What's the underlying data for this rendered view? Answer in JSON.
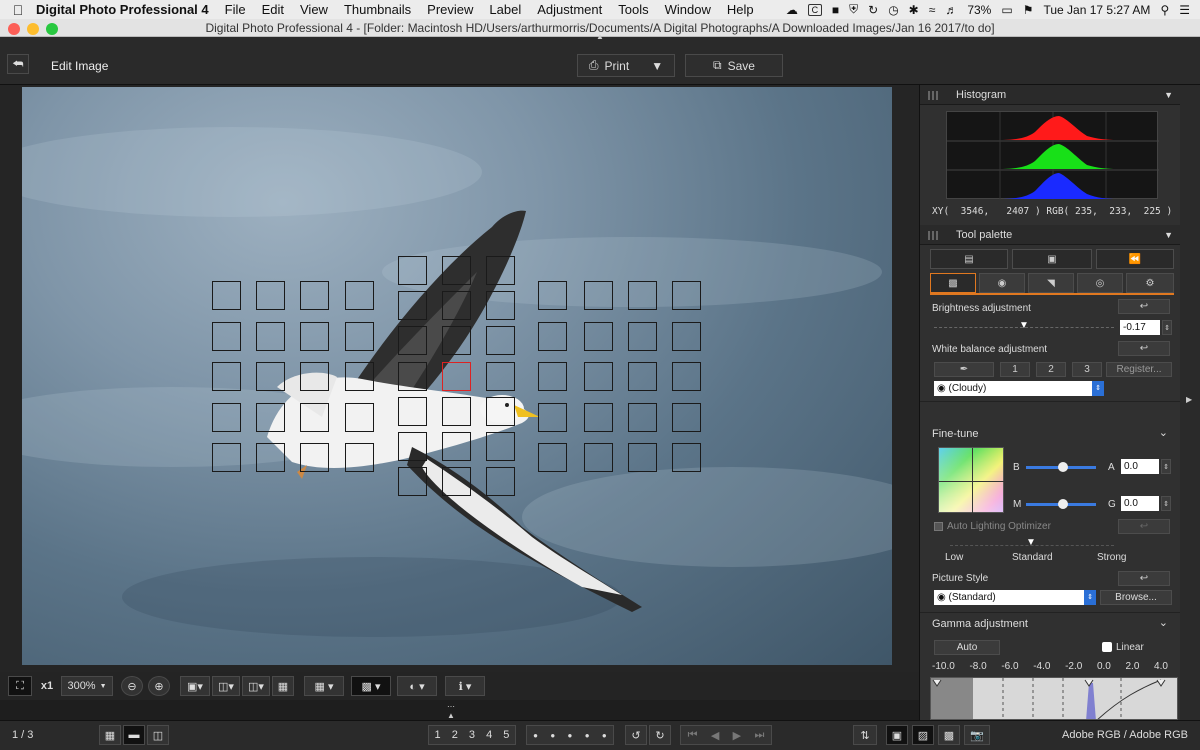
{
  "menubar": {
    "app_name": "Digital Photo Professional 4",
    "items": [
      "File",
      "Edit",
      "View",
      "Thumbnails",
      "Preview",
      "Label",
      "Adjustment",
      "Tools",
      "Window",
      "Help"
    ],
    "battery": "73%",
    "clock": "Tue Jan 17  5:27 AM"
  },
  "window": {
    "title": "Digital Photo Professional 4 - [Folder: Macintosh HD/Users/arthurmorris/Documents/A Digital Photographs/A Downloaded Images/Jan 16 2017/to do]"
  },
  "toolbar": {
    "mode_label": "Edit Image",
    "print_label": "Print",
    "save_label": "Save"
  },
  "histogram": {
    "title": "Histogram",
    "readout": "XY(  3546,   2407 ) RGB( 235,  233,  225 )"
  },
  "tool_palette": {
    "title": "Tool palette",
    "brightness_label": "Brightness adjustment",
    "brightness_value": "-0.17",
    "brightness_level": 0.5,
    "wb_label": "White balance adjustment",
    "wb_buttons": [
      "1",
      "2",
      "3"
    ],
    "register_label": "Register...",
    "wb_preset": "(Cloudy)"
  },
  "fine_tune": {
    "title": "Fine-tune",
    "b_label": "B",
    "a_label": "A",
    "a_value": "0.0",
    "m_label": "M",
    "g_label": "G",
    "g_value": "0.0",
    "alo_label": "Auto Lighting Optimizer",
    "alo_levels": [
      "Low",
      "Standard",
      "Strong"
    ],
    "picture_style_label": "Picture Style",
    "picture_style_value": "(Standard)",
    "browse_label": "Browse..."
  },
  "gamma": {
    "title": "Gamma adjustment",
    "auto_label": "Auto",
    "linear_label": "Linear",
    "scale": [
      "-10.0",
      "-8.0",
      "-6.0",
      "-4.0",
      "-2.0",
      "0.0",
      "2.0",
      "4.0"
    ]
  },
  "viewer_controls": {
    "x1_label": "x1",
    "zoom_value": "300%"
  },
  "statusbar": {
    "page_counter": "1 / 3",
    "ratings": [
      "1",
      "2",
      "3",
      "4",
      "5"
    ],
    "color_space": "Adobe RGB / Adobe RGB"
  },
  "colors": {
    "af_active": "#dd2222",
    "hist_red": "#ff1a1a",
    "hist_green": "#18e018",
    "hist_blue": "#1a2aff"
  }
}
